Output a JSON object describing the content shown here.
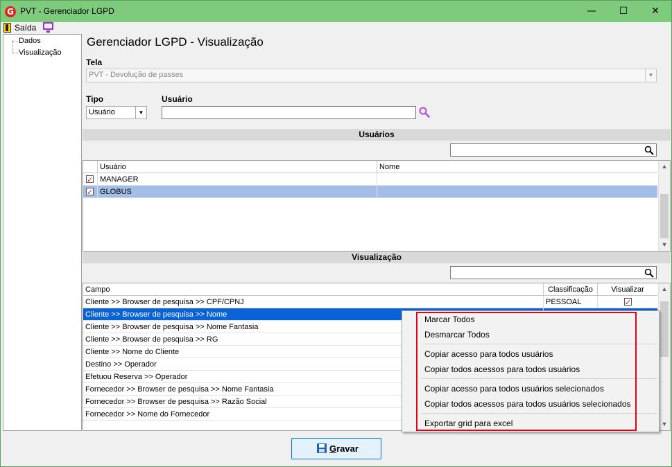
{
  "window": {
    "title": "PVT - Gerenciador LGPD",
    "app_icon": "G"
  },
  "menu": {
    "exit_label": "Saída"
  },
  "tree": {
    "items": [
      "Dados",
      "Visualização"
    ]
  },
  "page": {
    "title": "Gerenciador LGPD - Visualização"
  },
  "form": {
    "tela_label": "Tela",
    "tela_value": "PVT - Devolução de passes",
    "tipo_label": "Tipo",
    "tipo_value": "Usuário",
    "usuario_label": "Usuário",
    "usuario_value": ""
  },
  "users_section": {
    "title": "Usuários",
    "filter_value": "",
    "columns": [
      "Usuário",
      "Nome"
    ],
    "rows": [
      {
        "checked": true,
        "usuario": "MANAGER",
        "nome": ""
      },
      {
        "checked": true,
        "usuario": "GLOBUS",
        "nome": ""
      }
    ]
  },
  "visual_section": {
    "title": "Visualização",
    "filter_value": "",
    "columns": [
      "Campo",
      "Classificação",
      "Visualizar"
    ],
    "rows": [
      {
        "campo": "Cliente >> Browser de pesquisa >> CPF/CPNJ",
        "classificacao": "PESSOAL",
        "visualizar": true
      },
      {
        "campo": "Cliente >> Browser de pesquisa >> Nome",
        "classificacao": "",
        "visualizar": false
      },
      {
        "campo": "Cliente >> Browser de pesquisa >> Nome Fantasia",
        "classificacao": "",
        "visualizar": false
      },
      {
        "campo": "Cliente >> Browser de pesquisa >> RG",
        "classificacao": "",
        "visualizar": false
      },
      {
        "campo": "Cliente >> Nome do Cliente",
        "classificacao": "",
        "visualizar": false
      },
      {
        "campo": "Destino >> Operador",
        "classificacao": "",
        "visualizar": false
      },
      {
        "campo": "Efetuou Reserva >> Operador",
        "classificacao": "",
        "visualizar": false
      },
      {
        "campo": "Fornecedor >> Browser de pesquisa >> Nome Fantasia",
        "classificacao": "",
        "visualizar": false
      },
      {
        "campo": "Fornecedor >> Browser de pesquisa >> Razão Social",
        "classificacao": "",
        "visualizar": false
      },
      {
        "campo": "Fornecedor >> Nome do Fornecedor",
        "classificacao": "",
        "visualizar": false
      }
    ]
  },
  "context_menu": {
    "items": [
      "Marcar Todos",
      "Desmarcar Todos",
      "Copiar acesso para todos usuários",
      "Copiar todos acessos para todos usuários",
      "Copiar acesso para todos usuários selecionados",
      "Copiar todos acessos para todos usuários selecionados",
      "Exportar grid para excel"
    ]
  },
  "footer": {
    "save_mnemonic": "G",
    "save_rest": "ravar"
  },
  "colors": {
    "titlebar": "#7ecb7e",
    "selection": "#a3bde6",
    "selection_active": "#0a63d6",
    "highlight_frame": "#e2001a"
  }
}
